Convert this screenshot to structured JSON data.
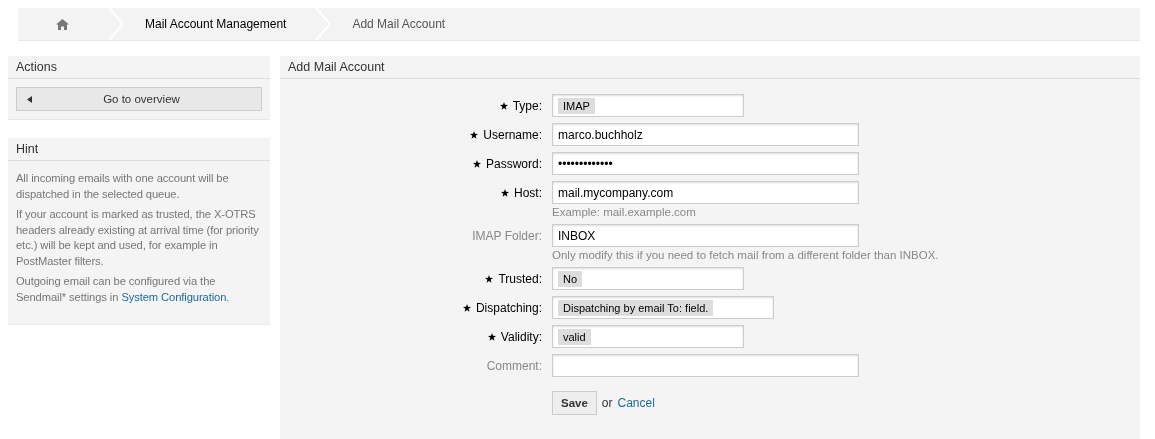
{
  "breadcrumb": [
    {
      "kind": "home"
    },
    {
      "kind": "link",
      "label": "Mail Account Management"
    },
    {
      "kind": "current",
      "label": "Add Mail Account"
    }
  ],
  "sidebar": {
    "actions": {
      "title": "Actions",
      "button": "Go to overview"
    },
    "hint": {
      "title": "Hint",
      "paragraphs": [
        {
          "text": "All incoming emails with one account will be dispatched in the selected queue."
        },
        {
          "text": "If your account is marked as trusted, the X-OTRS headers already existing at arrival time (for priority etc.) will be kept and used, for example in PostMaster filters."
        },
        {
          "text": "Outgoing email can be configured via the Sendmail* settings in ",
          "link": "System Configuration",
          "after": "."
        }
      ]
    }
  },
  "form": {
    "title": "Add Mail Account",
    "fields": [
      {
        "label": "Type:",
        "required": true,
        "kind": "select",
        "value": "IMAP"
      },
      {
        "label": "Username:",
        "required": true,
        "kind": "text",
        "value": "marco.buchholz"
      },
      {
        "label": "Password:",
        "required": true,
        "kind": "password",
        "value": "•••••••••••••"
      },
      {
        "label": "Host:",
        "required": true,
        "kind": "text",
        "value": "mail.mycompany.com",
        "hint": "Example: mail.example.com"
      },
      {
        "label": "IMAP Folder:",
        "required": false,
        "kind": "text",
        "value": "INBOX",
        "hint": "Only modify this if you need to fetch mail from a different folder than INBOX."
      },
      {
        "label": "Trusted:",
        "required": true,
        "kind": "select",
        "value": "No"
      },
      {
        "label": "Dispatching:",
        "required": true,
        "kind": "select",
        "value": "Dispatching by email To: field."
      },
      {
        "label": "Validity:",
        "required": true,
        "kind": "select",
        "value": "valid"
      },
      {
        "label": "Comment:",
        "required": false,
        "kind": "text"
      }
    ],
    "save": "Save",
    "or": "or",
    "cancel": "Cancel"
  }
}
